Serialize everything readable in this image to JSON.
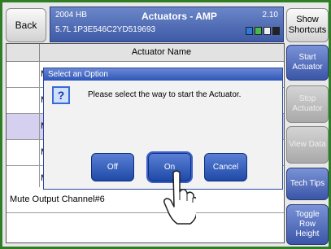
{
  "header": {
    "back_label": "Back",
    "vehicle_year_make": "2004 HB",
    "title": "Actuators - AMP",
    "version": "2.10",
    "engine_vin": "5.7L  1P3E546C2YD519693",
    "show_shortcuts_label": "Show Shortcuts",
    "status_colors": [
      "#2a7ad8",
      "#4ab84a",
      "#eeeeee",
      "#222222"
    ]
  },
  "table": {
    "column_header": "Actuator Name",
    "rows": [
      {
        "label": "M",
        "selected": false
      },
      {
        "label": "M",
        "selected": false
      },
      {
        "label": "M",
        "selected": true
      },
      {
        "label": "M",
        "selected": false
      },
      {
        "label": "M",
        "selected": false
      },
      {
        "label": "Mute Output Channel#6",
        "selected": false
      }
    ]
  },
  "sidebar": {
    "start_actuator": "Start Actuator",
    "stop_actuator": "Stop Actuator",
    "view_data": "View Data",
    "tech_tips": "Tech Tips",
    "toggle_row_height": "Toggle Row Height"
  },
  "dialog": {
    "title": "Select an Option",
    "message": "Please select the way to start the Actuator.",
    "icon": "question-icon",
    "off_label": "Off",
    "on_label": "On",
    "cancel_label": "Cancel"
  },
  "colors": {
    "frame": "#2f7e26",
    "header_blue": "#3e5aa6",
    "button_blue": "#1e4aa8",
    "selected_row": "#d6d0f0"
  }
}
